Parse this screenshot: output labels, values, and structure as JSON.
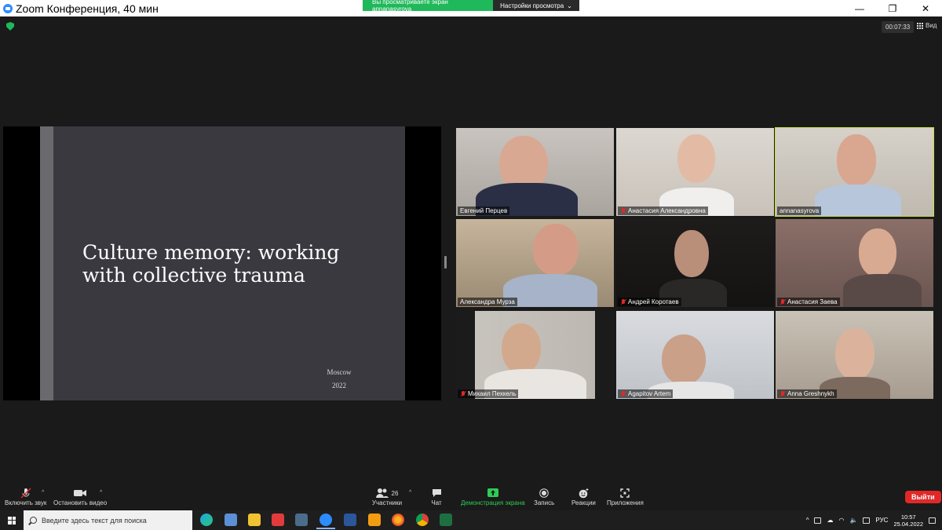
{
  "window": {
    "title": "Zoom Конференция, 40 мин",
    "minimize": "—",
    "restore": "❐",
    "close": "✕"
  },
  "share_banner": {
    "viewing": "Вы просматриваете экран annanasyrova",
    "view_settings": "Настройки просмотра"
  },
  "meeting": {
    "elapsed": "00:07:33",
    "view_label": "Вид"
  },
  "slide": {
    "title_line1": "Culture memory: working",
    "title_line2": "with collective trauma",
    "city": "Moscow",
    "year": "2022"
  },
  "participants": [
    {
      "name": "Евгений Перцев",
      "muted": false
    },
    {
      "name": "Анастасия Александровна",
      "muted": true
    },
    {
      "name": "annanasyrova",
      "muted": false,
      "active": true
    },
    {
      "name": "Александра Мурза",
      "muted": false
    },
    {
      "name": "Андрей Коротаев",
      "muted": true
    },
    {
      "name": "Анастасия Заева",
      "muted": true
    },
    {
      "name": "Михаил Пехкель",
      "muted": true
    },
    {
      "name": "Agapitov Artem",
      "muted": true
    },
    {
      "name": "Anna Greshnykh",
      "muted": true
    }
  ],
  "toolbar": {
    "unmute": "Включить звук",
    "start_video": "Остановить видео",
    "participants": "Участники",
    "participants_count": "26",
    "chat": "Чат",
    "share_screen": "Демонстрация экрана",
    "record": "Запись",
    "reactions": "Реакции",
    "apps": "Приложения",
    "leave": "Выйти"
  },
  "taskbar": {
    "search_placeholder": "Введите здесь текст для поиска",
    "language": "РУС",
    "time": "10:57",
    "date": "25.04.2022"
  },
  "colors": {
    "zoom_blue": "#2d8cff",
    "share_green": "#1fb85a",
    "active_speaker": "#c5e23a",
    "leave_red": "#e02828"
  }
}
